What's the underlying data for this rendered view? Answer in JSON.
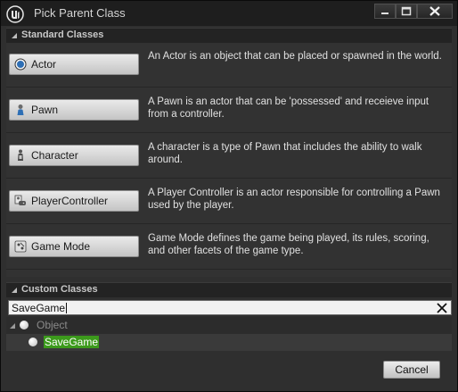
{
  "window": {
    "title": "Pick Parent Class",
    "controls": [
      "minimize-icon",
      "maximize-icon",
      "close-icon"
    ]
  },
  "standard_section": {
    "label": "Standard Classes",
    "items": [
      {
        "label": "Actor",
        "icon": "actor-icon",
        "description": "An Actor is an object that can be placed or spawned in the world."
      },
      {
        "label": "Pawn",
        "icon": "pawn-icon",
        "description": "A Pawn is an actor that can be 'possessed' and receieve input from a controller."
      },
      {
        "label": "Character",
        "icon": "character-icon",
        "description": "A character is a type of Pawn that includes the ability to walk around."
      },
      {
        "label": "PlayerController",
        "icon": "player-controller-icon",
        "description": "A Player Controller is an actor responsible for controlling a Pawn used by the player."
      },
      {
        "label": "Game Mode",
        "icon": "game-mode-icon",
        "description": "Game Mode defines the game being played, its rules, scoring, and other facets of the game type."
      }
    ]
  },
  "custom_section": {
    "label": "Custom Classes",
    "search": {
      "value": "SaveGame"
    },
    "tree": [
      {
        "label": "Object",
        "expanded": true
      },
      {
        "label": "SaveGame",
        "highlighted": true
      }
    ]
  },
  "footer": {
    "cancel_label": "Cancel"
  },
  "colors": {
    "title_bar": "#1e1e1e",
    "panel": "#323232",
    "highlight": "#3c9a1c"
  }
}
